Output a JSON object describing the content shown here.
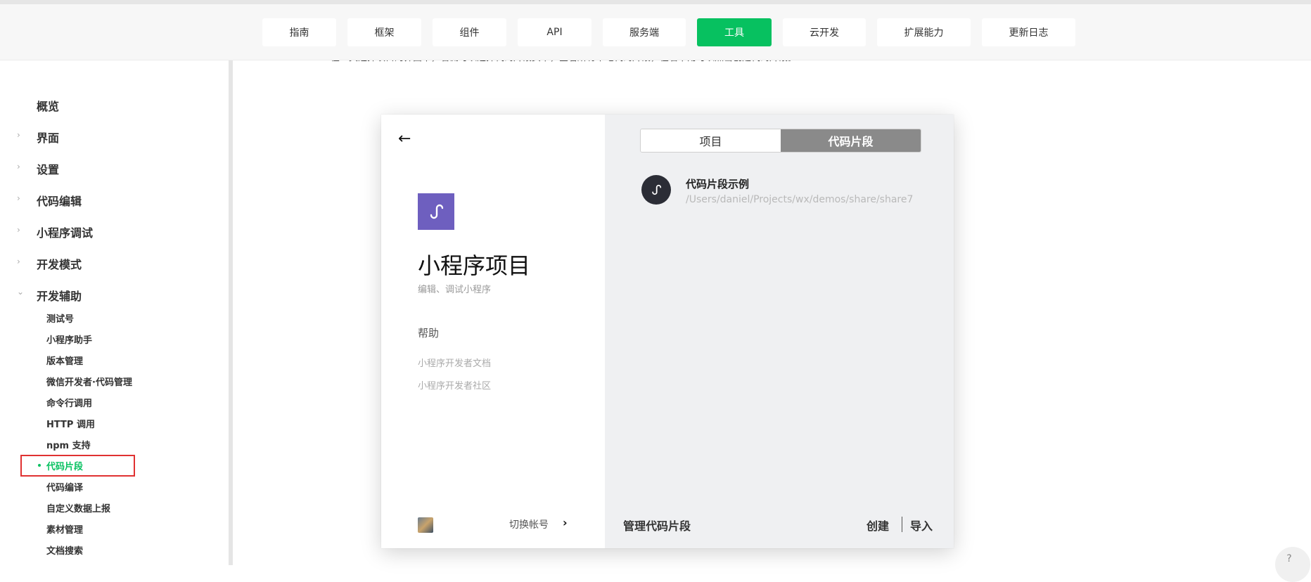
{
  "nav": {
    "items": [
      {
        "label": "指南"
      },
      {
        "label": "框架"
      },
      {
        "label": "组件"
      },
      {
        "label": "API"
      },
      {
        "label": "服务端"
      },
      {
        "label": "工具"
      },
      {
        "label": "云开发"
      },
      {
        "label": "扩展能力"
      },
      {
        "label": "更新日志"
      }
    ],
    "active": "工具",
    "accent": "#07c160"
  },
  "intro_text": "在工具选择项目的界面中，右侧可以选择代码片段页卡，查看所有本地代码片段，在右下角可以点击创建代码片段。",
  "sidebar": {
    "top_items": [
      {
        "label": "概览"
      },
      {
        "label": "界面"
      },
      {
        "label": "设置"
      },
      {
        "label": "代码编辑"
      },
      {
        "label": "小程序调试"
      },
      {
        "label": "开发模式"
      },
      {
        "label": "开发辅助"
      }
    ],
    "sub_items": [
      {
        "label": "测试号"
      },
      {
        "label": "小程序助手"
      },
      {
        "label": "版本管理"
      },
      {
        "label": "微信开发者·代码管理"
      },
      {
        "label": "命令行调用"
      },
      {
        "label": "HTTP 调用"
      },
      {
        "label": "npm 支持"
      },
      {
        "label": "代码片段"
      },
      {
        "label": "代码编译"
      },
      {
        "label": "自定义数据上报"
      },
      {
        "label": "素材管理"
      },
      {
        "label": "文档搜索"
      }
    ],
    "active_sub": "代码片段"
  },
  "window": {
    "left": {
      "title": "小程序项目",
      "subtitle": "编辑、调试小程序",
      "help_title": "帮助",
      "help_links": [
        {
          "label": "小程序开发者文档"
        },
        {
          "label": "小程序开发者社区"
        }
      ],
      "switch_account": "切换帐号"
    },
    "right": {
      "tabs": [
        {
          "label": "项目"
        },
        {
          "label": "代码片段"
        }
      ],
      "active_tab": "代码片段",
      "snippet": {
        "name": "代码片段示例",
        "path": "/Users/daniel/Projects/wx/demos/share/share7"
      },
      "manage_label": "管理代码片段",
      "create_label": "创建",
      "import_label": "导入"
    }
  },
  "help_button": "?"
}
